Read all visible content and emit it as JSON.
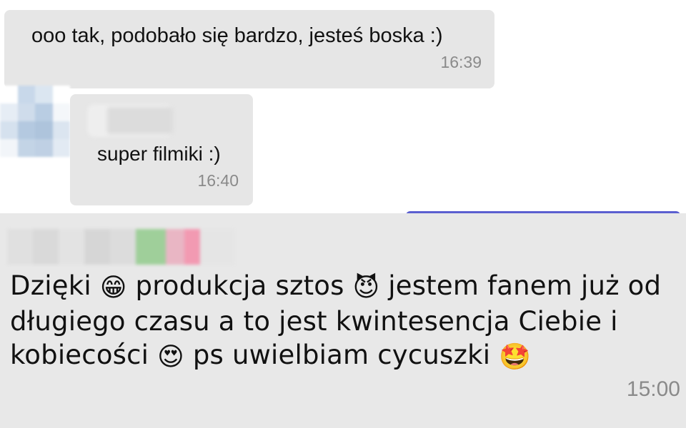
{
  "messages": [
    {
      "text": "ooo tak, podobało się bardzo, jesteś boska :)",
      "time": "16:39"
    },
    {
      "text": "super filmiki :)",
      "time": "16:40"
    },
    {
      "lines": [
        [
          "Dzięki ",
          "😁",
          " produkcja sztos ",
          "😈",
          " jestem fanem już od"
        ],
        [
          "długiego czasu a to jest kwintesencja Ciebie i"
        ],
        [
          "kobiecości ",
          "😍",
          " ps uwielbiam cycuszki ",
          "🤩"
        ]
      ],
      "time": "15:00"
    }
  ]
}
